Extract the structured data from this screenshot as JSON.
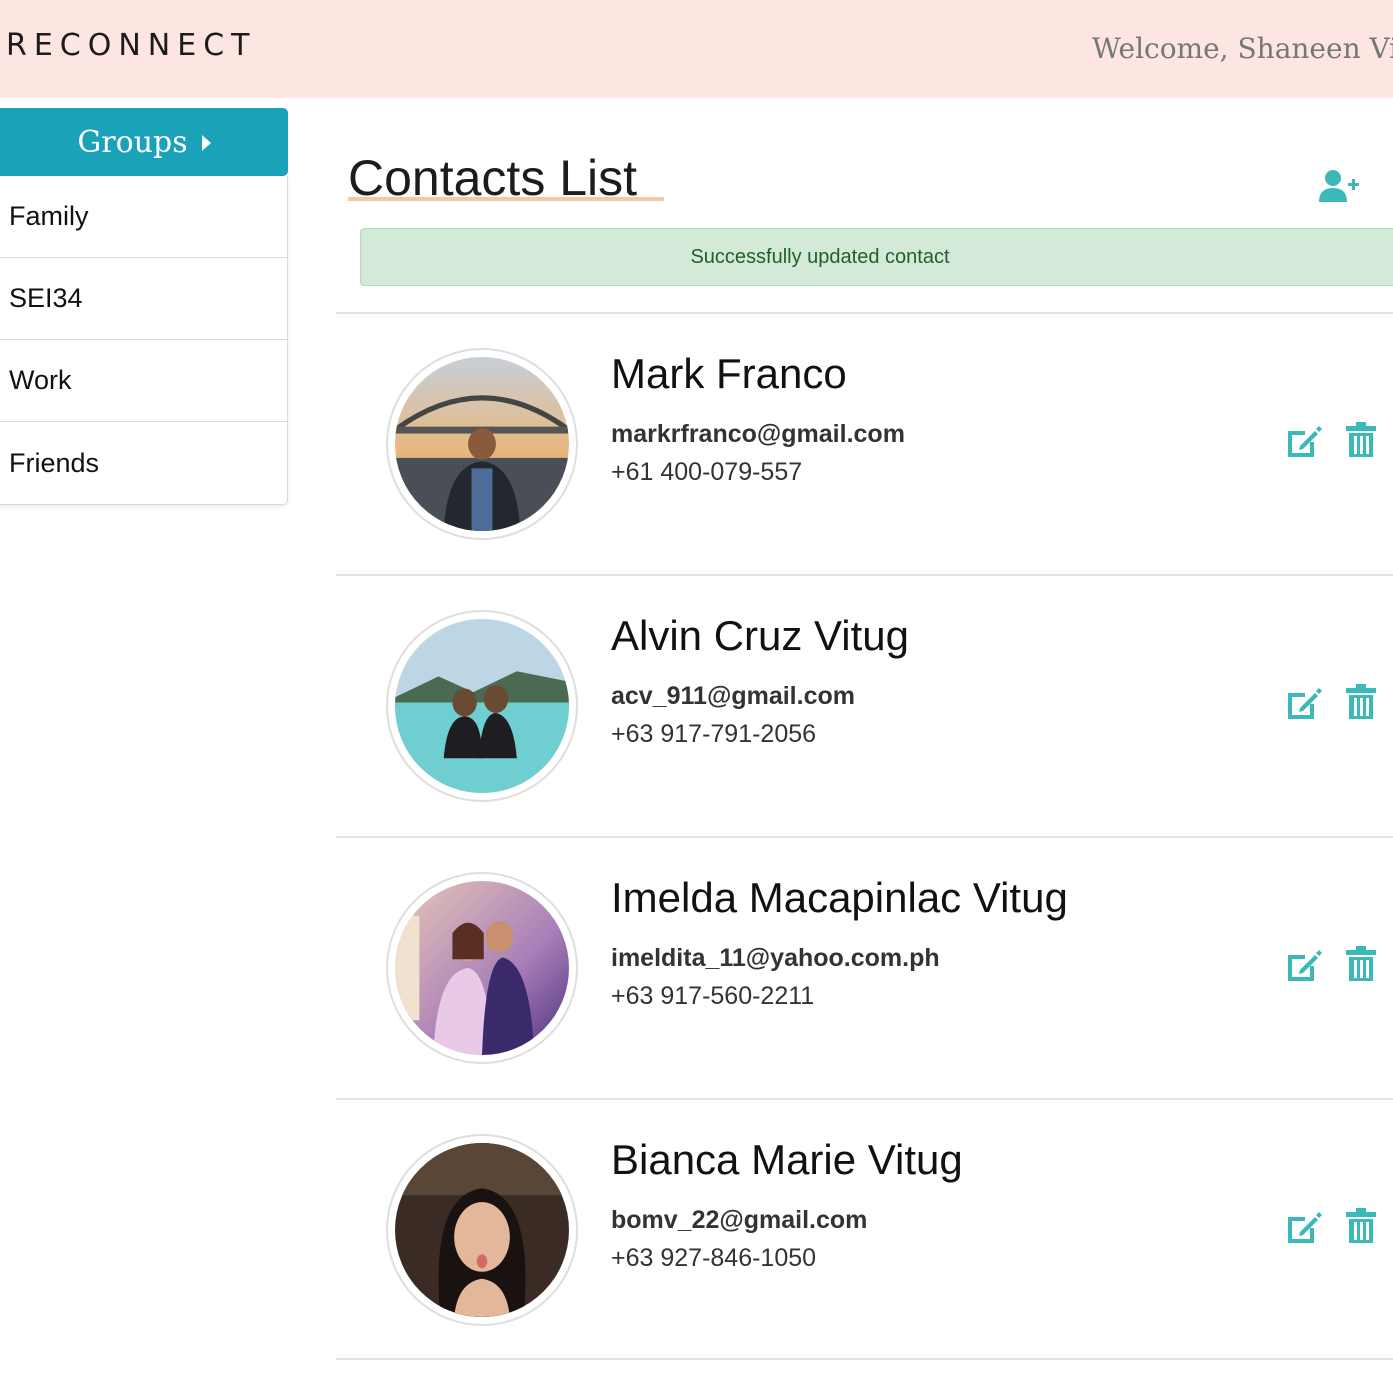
{
  "header": {
    "logo": "RECONNECT",
    "welcome": "Welcome, Shaneen Vitug"
  },
  "sidebar": {
    "groups_label": "Groups",
    "items": [
      {
        "label": "Family"
      },
      {
        "label": "SEI34"
      },
      {
        "label": "Work"
      },
      {
        "label": "Friends"
      }
    ]
  },
  "main": {
    "title": "Contacts List",
    "add_contact_icon": "user-plus-icon",
    "alert": "Successfully updated contact",
    "contacts": [
      {
        "name": "Mark Franco",
        "email": "markrfranco@gmail.com",
        "phone": "+61 400-079-557"
      },
      {
        "name": "Alvin Cruz Vitug",
        "email": "acv_911@gmail.com",
        "phone": "+63 917-791-2056"
      },
      {
        "name": "Imelda Macapinlac Vitug",
        "email": "imeldita_11@yahoo.com.ph",
        "phone": "+63 917-560-2211"
      },
      {
        "name": "Bianca Marie Vitug",
        "email": "bomv_22@gmail.com",
        "phone": "+63 927-846-1050"
      }
    ],
    "row_icons": {
      "edit": "edit-icon",
      "delete": "trash-icon"
    }
  },
  "colors": {
    "header_bg": "#fde6e1",
    "accent": "#1aa2b9",
    "icon_teal": "#3bb8b8",
    "alert_bg": "#d4ead8",
    "alert_text": "#1f5f2e",
    "title_underline": "#f6c7a5"
  }
}
